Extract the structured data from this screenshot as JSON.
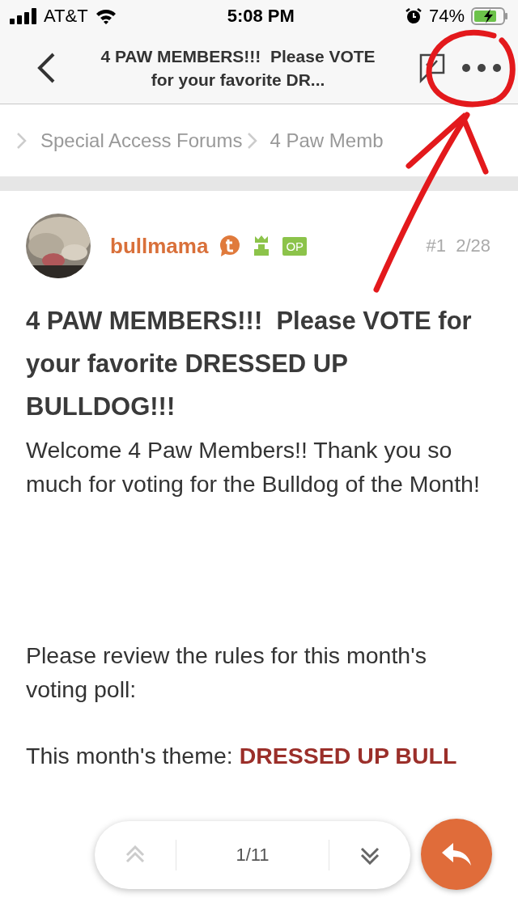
{
  "status_bar": {
    "carrier": "AT&T",
    "time": "5:08 PM",
    "battery": "74%",
    "alarm": true,
    "charging": true
  },
  "nav": {
    "title": "4 PAW MEMBERS!!!  Please VOTE for your favorite DR..."
  },
  "breadcrumb": [
    "Special Access Forums",
    "4 Paw Memb"
  ],
  "post": {
    "author": "bullmama",
    "badges": [
      {
        "kind": "talk",
        "color": "#e07a3c"
      },
      {
        "kind": "crown",
        "color": "#8cc34a"
      },
      {
        "kind": "label",
        "text": "OP",
        "color": "#8cc34a"
      }
    ],
    "number": "#1",
    "date": "2/28",
    "title": "4 PAW MEMBERS!!!  Please VOTE for your favorite DRESSED UP BULLDOG!!!",
    "paragraphs": [
      {
        "kind": "text",
        "text": "Welcome 4 Paw Members!! Thank you so much for voting for the Bulldog of the Month!"
      },
      {
        "kind": "gap"
      },
      {
        "kind": "text",
        "text": "Please review the rules for this month's voting poll:"
      },
      {
        "kind": "text",
        "text": "This month's theme: **DRESSED UP BULL**"
      }
    ]
  },
  "pager": {
    "page": "1/11",
    "up_disabled": true,
    "down_disabled": false
  }
}
